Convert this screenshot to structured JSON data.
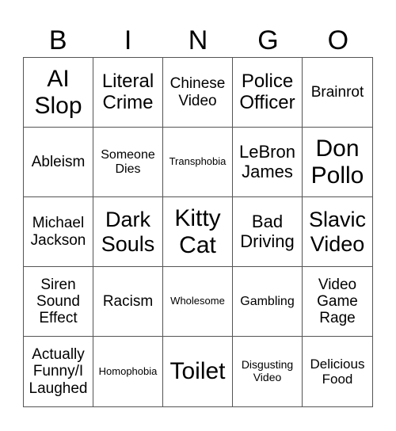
{
  "header": [
    "B",
    "I",
    "N",
    "G",
    "O"
  ],
  "cells": [
    "AI Slop",
    "Literal Crime",
    "Chinese Video",
    "Police Officer",
    "Brainrot",
    "Ableism",
    "Someone Dies",
    "Transphobia",
    "LeBron James",
    "Don Pollo",
    "Michael Jackson",
    "Dark Souls",
    "Kitty Cat",
    "Bad Driving",
    "Slavic Video",
    "Siren Sound Effect",
    "Racism",
    "Wholesome",
    "Gambling",
    "Video Game Rage",
    "Actually Funny/I Laughed",
    "Homophobia",
    "Toilet",
    "Disgusting Video",
    "Delicious Food"
  ]
}
